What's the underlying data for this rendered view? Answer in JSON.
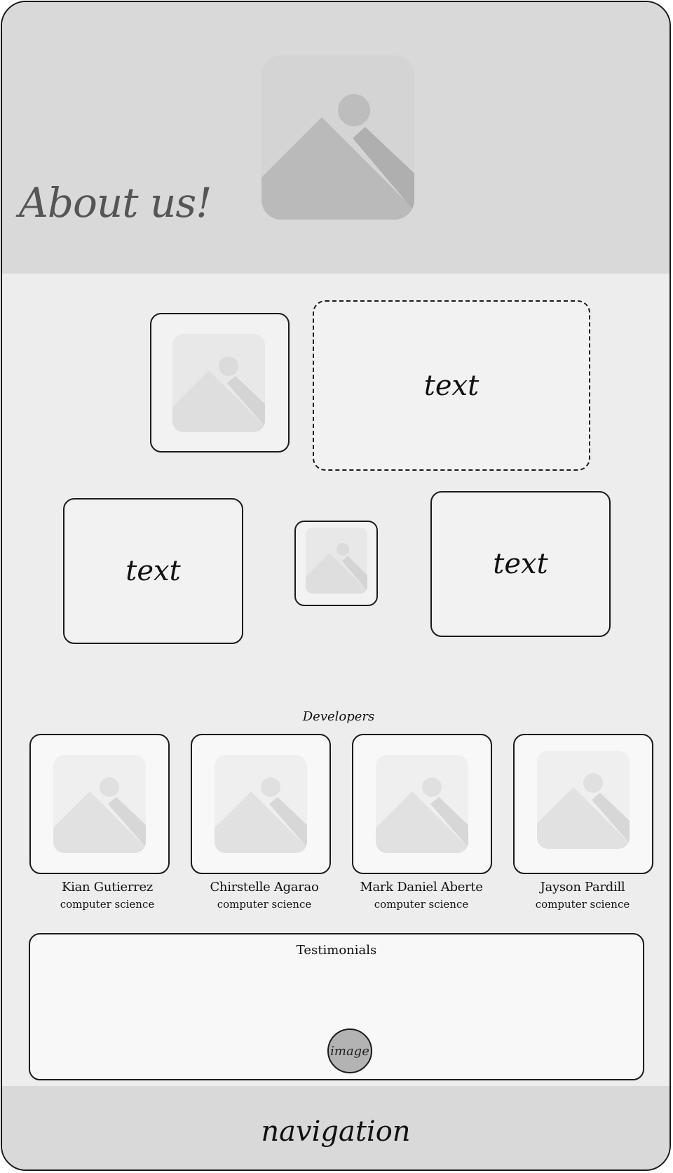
{
  "header": {
    "title": "About us!",
    "hero_image": "image-placeholder-icon"
  },
  "content": {
    "blocks": [
      {
        "kind": "image",
        "icon": "image-placeholder-icon"
      },
      {
        "kind": "text",
        "label": "text",
        "border": "dashed"
      },
      {
        "kind": "text",
        "label": "text"
      },
      {
        "kind": "image",
        "icon": "image-placeholder-icon"
      },
      {
        "kind": "text",
        "label": "text"
      }
    ]
  },
  "developers": {
    "title": "Developers",
    "members": [
      {
        "name": "Kian Gutierrez",
        "role": "computer science",
        "photo": "image-placeholder-icon"
      },
      {
        "name": "Chirstelle Agarao",
        "role": "computer science",
        "photo": "image-placeholder-icon"
      },
      {
        "name": "Mark Daniel Aberte",
        "role": "computer science",
        "photo": "image-placeholder-icon"
      },
      {
        "name": "Jayson Pardill",
        "role": "computer science",
        "photo": "image-placeholder-icon"
      }
    ]
  },
  "testimonials": {
    "title": "Testimonials",
    "avatar_label": "image"
  },
  "footer": {
    "label": "navigation"
  },
  "colors": {
    "header_bg": "#d9d9d9",
    "content_bg": "#ededed",
    "card_bg": "#f3f2f3",
    "border": "#1b1b1b",
    "placeholder": "#c6c6c6"
  }
}
